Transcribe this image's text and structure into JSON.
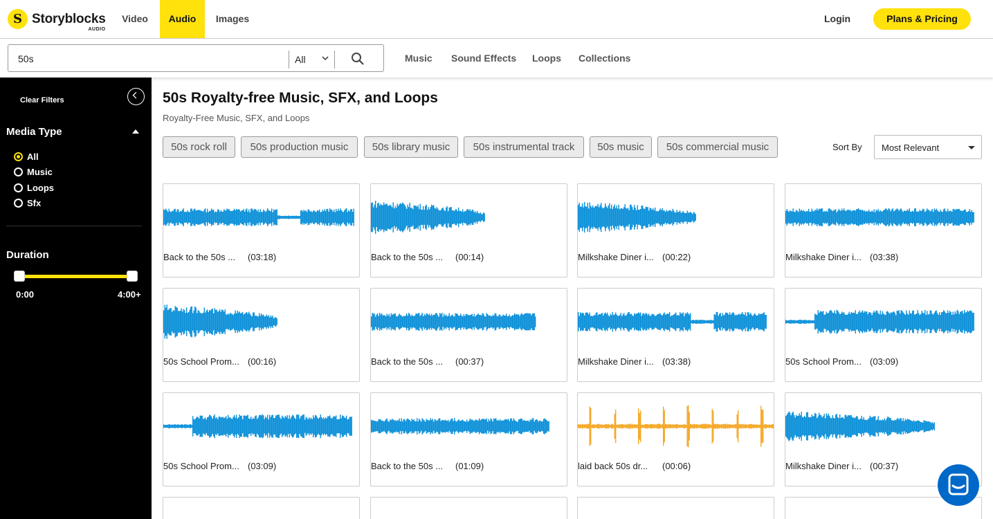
{
  "brand": {
    "name": "Storyblocks",
    "sub": "AUDIO",
    "mark": "S"
  },
  "nav": {
    "items": [
      "Video",
      "Audio",
      "Images"
    ],
    "active": "Audio"
  },
  "header": {
    "login": "Login",
    "plans": "Plans & Pricing"
  },
  "search": {
    "value": "50s",
    "scope": "All"
  },
  "subnav": [
    "Music",
    "Sound Effects",
    "Loops",
    "Collections"
  ],
  "sidebar": {
    "clear_filters": "Clear Filters",
    "media_type_title": "Media Type",
    "media_types": [
      "All",
      "Music",
      "Loops",
      "Sfx"
    ],
    "selected_media_type": "All",
    "duration_title": "Duration",
    "duration_min": "0:00",
    "duration_max": "4:00+"
  },
  "main": {
    "title": "50s Royalty-free Music, SFX, and Loops",
    "subtitle": "Royalty-Free Music, SFX, and Loops",
    "tags": [
      "50s rock roll",
      "50s production music",
      "50s library music",
      "50s instrumental track",
      "50s music",
      "50s commercial music"
    ],
    "sort_label": "Sort By",
    "sort_value": "Most Relevant"
  },
  "results": [
    {
      "title": "Back to the 50s ...",
      "duration": "(03:18)"
    },
    {
      "title": "Back to the 50s ...",
      "duration": "(00:14)"
    },
    {
      "title": "Milkshake Diner i...",
      "duration": "(00:22)"
    },
    {
      "title": "Milkshake Diner i...",
      "duration": "(03:38)"
    },
    {
      "title": "50s School Prom...",
      "duration": "(00:16)"
    },
    {
      "title": "Back to the 50s ...",
      "duration": "(00:37)"
    },
    {
      "title": "Milkshake Diner i...",
      "duration": "(03:38)"
    },
    {
      "title": "50s School Prom...",
      "duration": "(03:09)"
    },
    {
      "title": "50s School Prom...",
      "duration": "(03:09)"
    },
    {
      "title": "Back to the 50s ...",
      "duration": "(01:09)"
    },
    {
      "title": "laid back 50s dr...",
      "duration": "(00:06)"
    },
    {
      "title": "Milkshake Diner i...",
      "duration": "(00:37)"
    }
  ],
  "colors": {
    "accent": "#ffe10b",
    "waveform": "#0a8fd8",
    "waveform_sfx": "#f5a623",
    "chat": "#0068c8"
  },
  "icons": {
    "search": "search-icon",
    "collapse": "chevron-left-circle-icon",
    "chat": "chat-icon"
  }
}
